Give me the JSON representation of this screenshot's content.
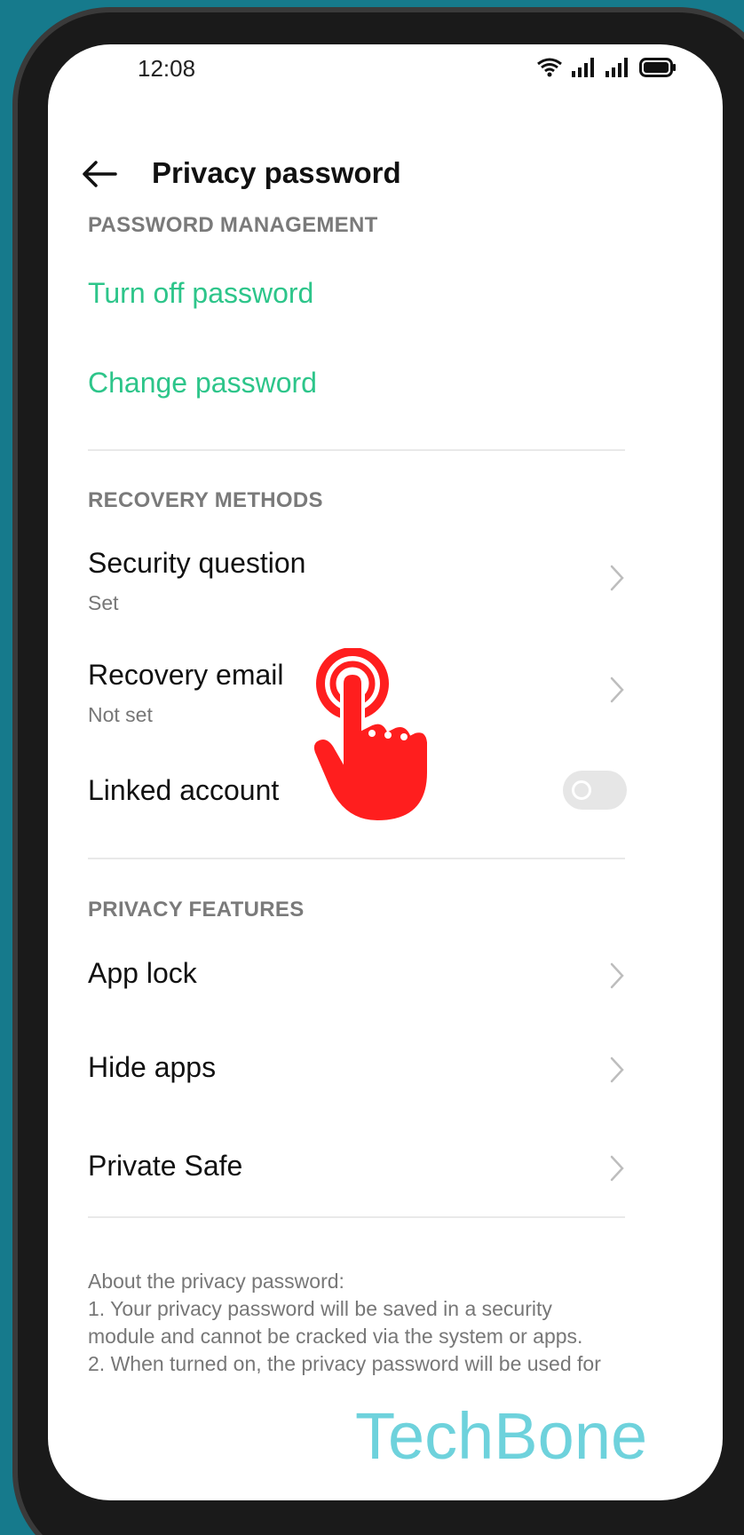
{
  "status_bar": {
    "time": "12:08",
    "icons": [
      "wifi-icon",
      "signal-icon",
      "signal-icon",
      "battery-icon"
    ]
  },
  "app_bar": {
    "title": "Privacy password",
    "back_icon": "back-arrow-icon"
  },
  "sections": {
    "password_management": {
      "header": "PASSWORD MANAGEMENT",
      "items": [
        {
          "label": "Turn off password"
        },
        {
          "label": "Change password"
        }
      ]
    },
    "recovery_methods": {
      "header": "RECOVERY METHODS",
      "items": [
        {
          "label": "Security question",
          "value": "Set"
        },
        {
          "label": "Recovery email",
          "value": "Not set"
        },
        {
          "label": "Linked account",
          "toggle": false
        }
      ]
    },
    "privacy_features": {
      "header": "PRIVACY FEATURES",
      "items": [
        {
          "label": "App lock"
        },
        {
          "label": "Hide apps"
        },
        {
          "label": "Private Safe"
        }
      ]
    }
  },
  "footer": {
    "line1": "About the privacy password:",
    "line2": "1. Your privacy password will be saved in a security",
    "line3": "module and cannot be cracked via the system or apps.",
    "line4": "2. When turned on, the privacy password will be used for"
  },
  "overlay": {
    "pointer_icon": "tap-hand-icon",
    "watermark": "TechBone"
  },
  "colors": {
    "background": "#167a8c",
    "accent_green": "#2dc58a",
    "pointer_red": "#ff1e1e",
    "watermark": "#55cbd6"
  }
}
